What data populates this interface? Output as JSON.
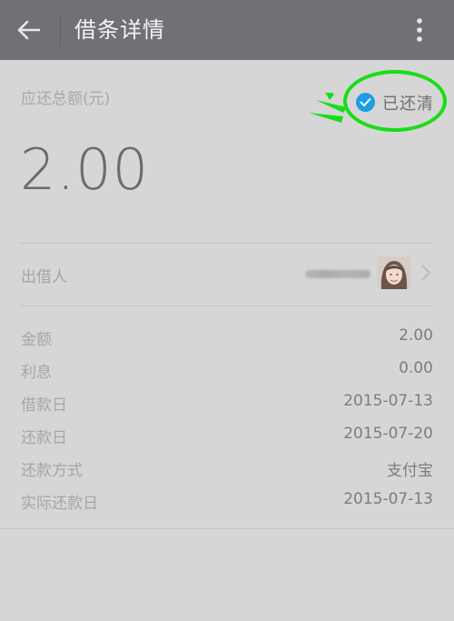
{
  "header": {
    "title": "借条详情",
    "back_icon": "arrow-left-icon",
    "menu_icon": "more-vertical-icon"
  },
  "summary": {
    "total_label": "应还总额(元)",
    "amount": "2.00",
    "status": "已还清",
    "status_icon": "check-circle-icon",
    "status_color": "#1c9fe5",
    "highlight_color": "#18dd18"
  },
  "lender": {
    "label": "出借人",
    "name_redacted": true,
    "chevron_icon": "chevron-right-icon"
  },
  "details": [
    {
      "label": "金额",
      "value": "2.00"
    },
    {
      "label": "利息",
      "value": "0.00"
    },
    {
      "label": "借款日",
      "value": "2015-07-13"
    },
    {
      "label": "还款日",
      "value": "2015-07-20"
    },
    {
      "label": "还款方式",
      "value": "支付宝"
    },
    {
      "label": "实际还款日",
      "value": "2015-07-13"
    }
  ]
}
